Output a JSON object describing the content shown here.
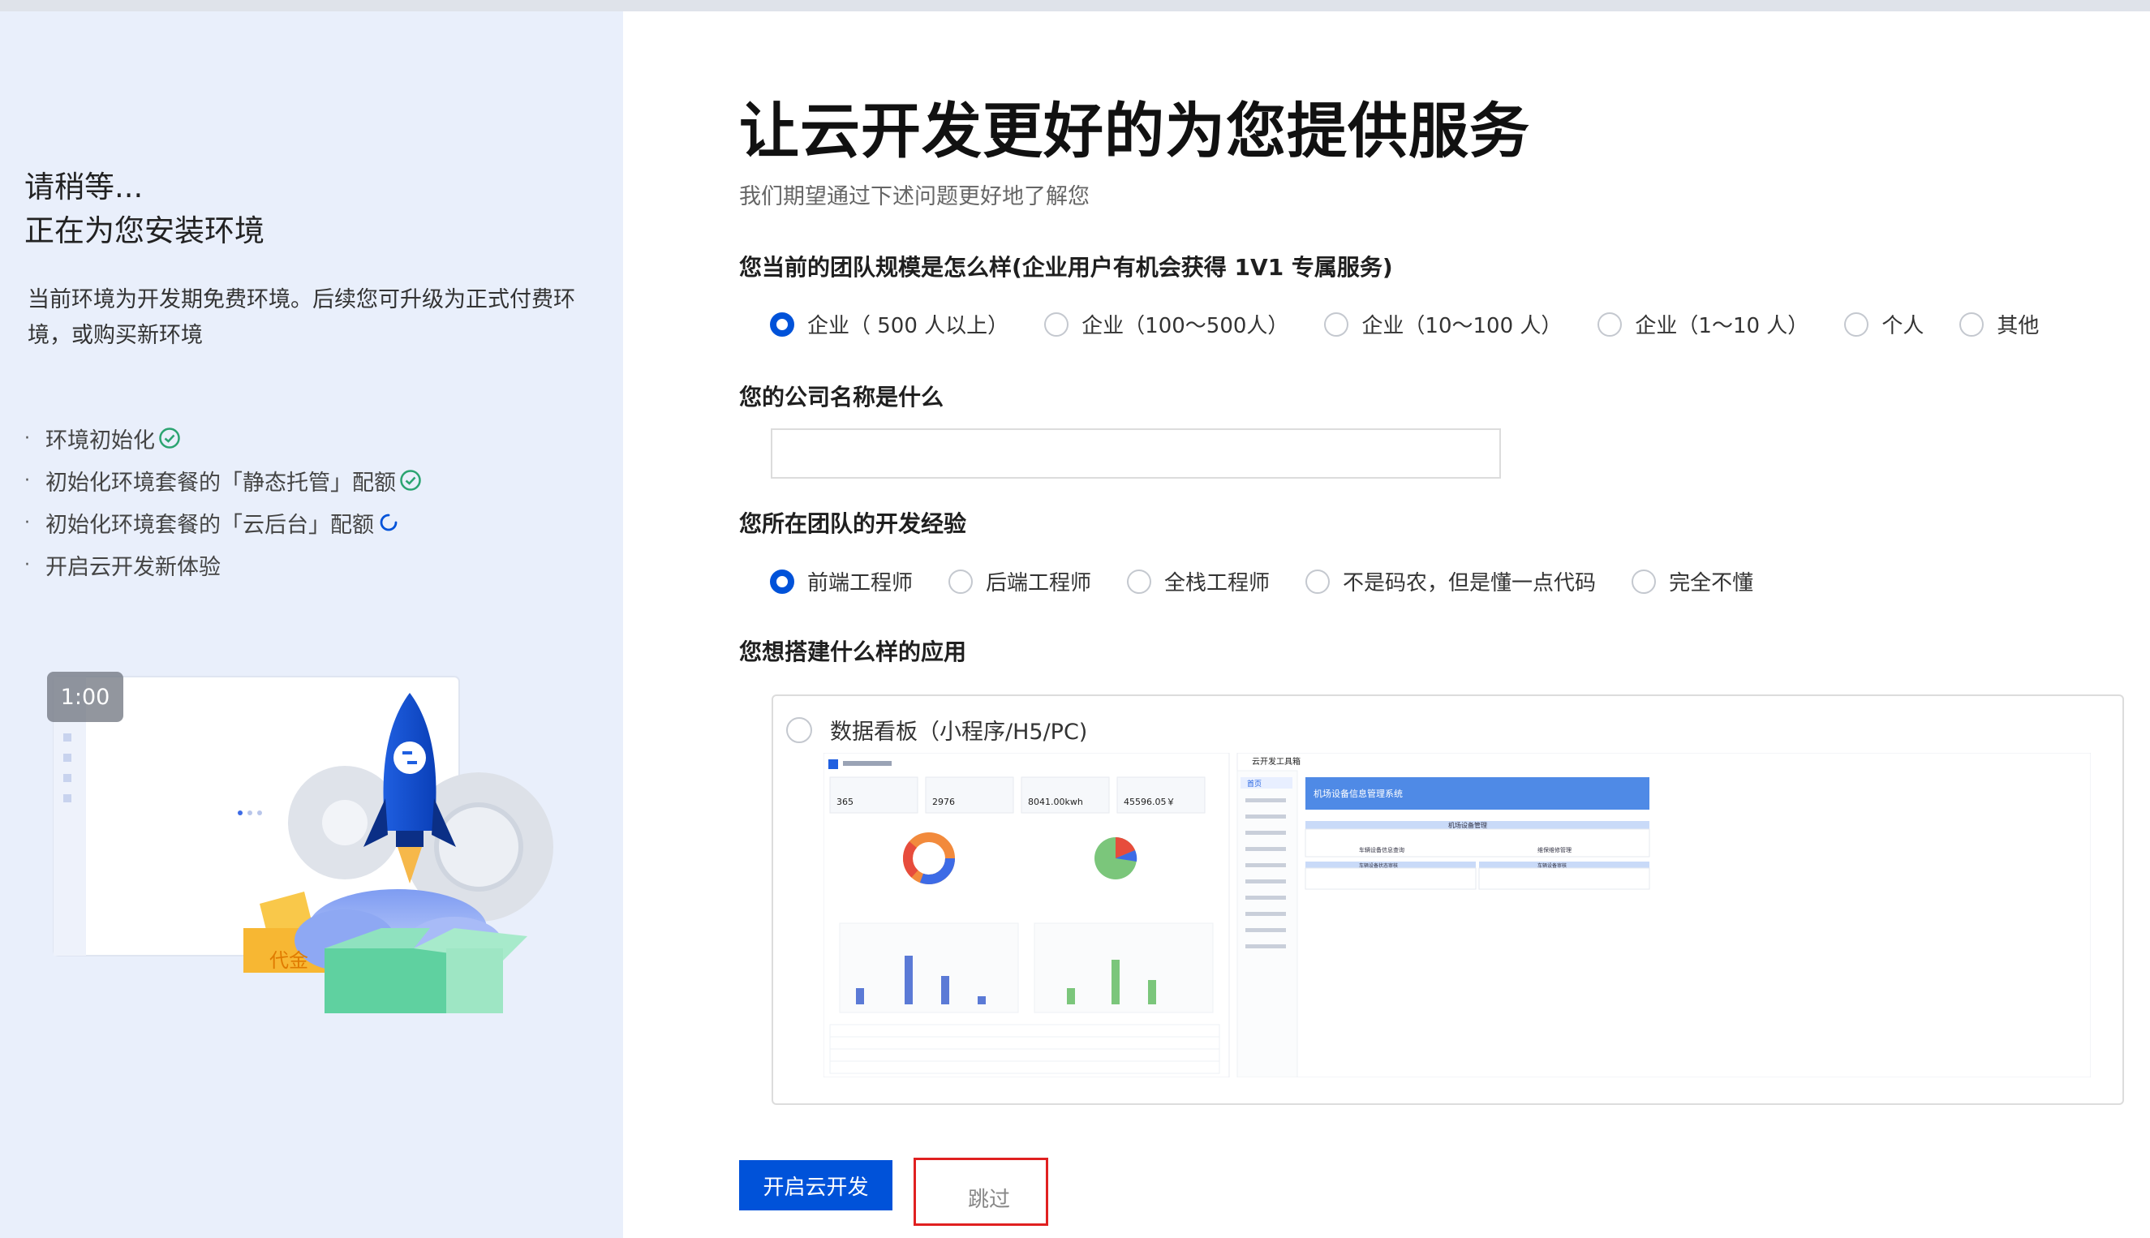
{
  "left": {
    "title_line1": "请稍等...",
    "title_line2": "正在为您安装环境",
    "description": "当前环境为开发期免费环境。后续您可升级为正式付费环境，或购买新环境",
    "steps": [
      {
        "label": "环境初始化",
        "status": "done"
      },
      {
        "label": "初始化环境套餐的「静态托管」配额",
        "status": "done"
      },
      {
        "label": "初始化环境套餐的「云后台」配额",
        "status": "loading"
      },
      {
        "label": "开启云开发新体验",
        "status": "pending"
      }
    ],
    "video_time": "1:00",
    "voucher_text": "代金"
  },
  "main": {
    "title": "让云开发更好的为您提供服务",
    "subtitle": "我们期望通过下述问题更好地了解您",
    "q1": {
      "label": "您当前的团队规模是怎么样(企业用户有机会获得 1V1 专属服务)",
      "options": [
        "企业（ 500 人以上）",
        "企业（100～500人）",
        "企业（10～100 人）",
        "企业（1～10 人）",
        "个人",
        "其他"
      ],
      "selected": 0
    },
    "q2": {
      "label": "您的公司名称是什么",
      "value": ""
    },
    "q3": {
      "label": "您所在团队的开发经验",
      "options": [
        "前端工程师",
        "后端工程师",
        "全栈工程师",
        "不是码农，但是懂一点代码",
        "完全不懂"
      ],
      "selected": 0
    },
    "q4": {
      "label": "您想搭建什么样的应用",
      "option": "数据看板（小程序/H5/PC)"
    },
    "preview": {
      "stats": [
        "365",
        "2976",
        "8041.00kwh",
        "45596.05￥"
      ],
      "tool_title": "云开发工具箱",
      "app_title": "机场设备信息管理系统",
      "nav_home": "首页",
      "panel_title": "机场设备管理",
      "card1": "车辆设备信息查询",
      "card2": "维保维修管理",
      "card3": "车辆设备状态审核",
      "card4": "车辆设备审核"
    },
    "start_button": "开启云开发",
    "skip_button": "跳过"
  },
  "colors": {
    "primary": "#0052d9",
    "success": "#2ba471",
    "left_bg": "#e9effb",
    "highlight": "#e02020"
  }
}
